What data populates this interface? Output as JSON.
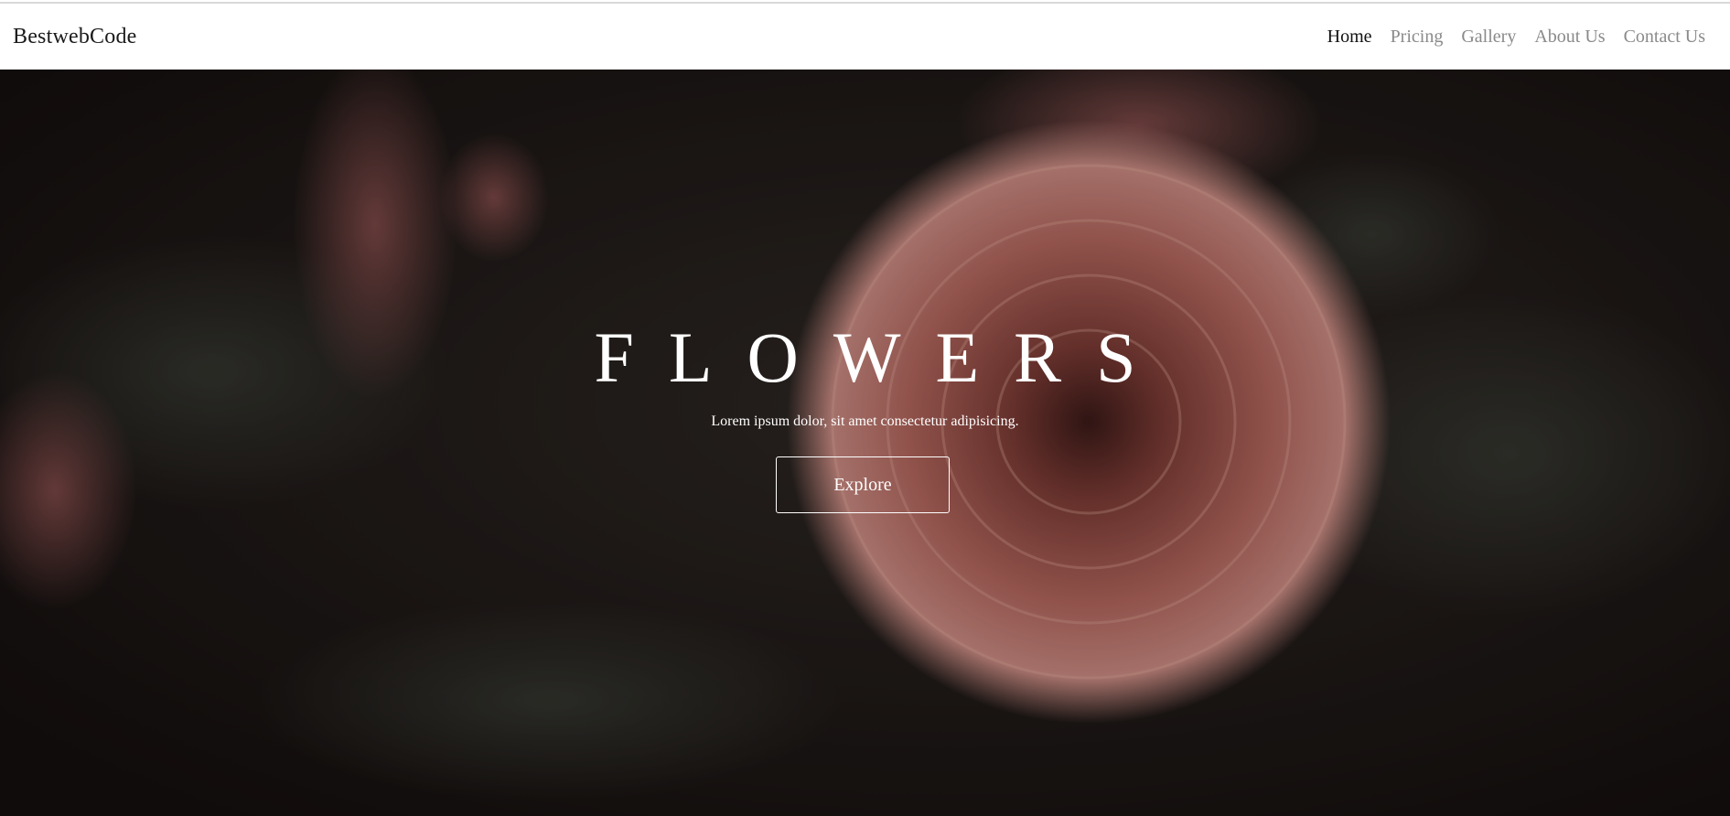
{
  "brand": {
    "name": "BestwebCode"
  },
  "nav": {
    "items": [
      {
        "label": "Home",
        "active": true
      },
      {
        "label": "Pricing",
        "active": false
      },
      {
        "label": "Gallery",
        "active": false
      },
      {
        "label": "About Us",
        "active": false
      },
      {
        "label": "Contact Us",
        "active": false
      }
    ]
  },
  "hero": {
    "title": "FLOWERS",
    "subtitle": "Lorem ipsum dolor, sit amet consectetur adipisicing.",
    "cta_label": "Explore",
    "background": "dark photo of a pink dahlia flower"
  },
  "colors": {
    "nav_active": "#111111",
    "nav_inactive": "#8a8a8a",
    "hero_bg": "#1a1614",
    "hero_text": "#ffffff"
  }
}
